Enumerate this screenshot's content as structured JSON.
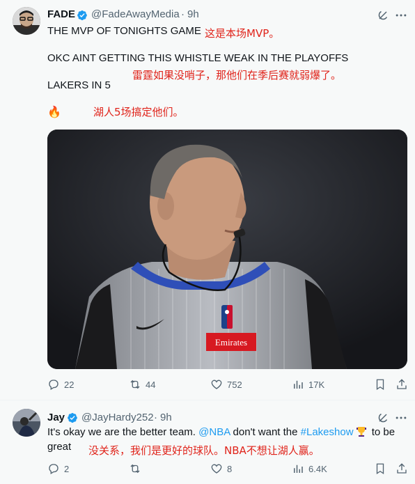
{
  "tweet1": {
    "author_name": "FADE",
    "author_handle": "@FadeAwayMedia",
    "separator": "·",
    "time": "9h",
    "lines": {
      "line1": "THE MVP OF TONIGHTS GAME",
      "line2": "OKC AINT GETTING THIS WHISTLE WEAK IN THE PLAYOFFS",
      "line3": "LAKERS IN 5",
      "emoji": "🔥"
    },
    "translations": {
      "t1": "这是本场MVP。",
      "t2": "雷霆如果没哨子，那他们在季后赛就弱爆了。",
      "t3": "湖人5场搞定他们。"
    },
    "media": {
      "jersey_sponsor": "Emirates"
    },
    "actions": {
      "replies": "22",
      "reposts": "44",
      "likes": "752",
      "views": "17K"
    }
  },
  "tweet2": {
    "author_name": "Jay",
    "author_handle": "@JayHardy252",
    "separator": "·",
    "time": "9h",
    "text": {
      "part1": "It's okay we are the better team. ",
      "mention": "@NBA",
      "part2": " don't want the ",
      "hashtag": "#Lakeshow",
      "part3": " to be",
      "line2": "great"
    },
    "translation": "没关系，我们是更好的球队。NBA不想让湖人赢。",
    "actions": {
      "replies": "2",
      "reposts": "",
      "likes": "8",
      "views": "6.4K"
    }
  },
  "colors": {
    "accent": "#1d9bf0",
    "text": "#0f1419",
    "muted": "#536471",
    "translation": "#e0231a",
    "background": "#f7f9f9"
  },
  "icons": [
    "verified-badge-icon",
    "grok-icon",
    "more-icon",
    "reply-icon",
    "repost-icon",
    "like-icon",
    "views-icon",
    "bookmark-icon",
    "share-icon",
    "fire-emoji",
    "trophy-emoji"
  ]
}
